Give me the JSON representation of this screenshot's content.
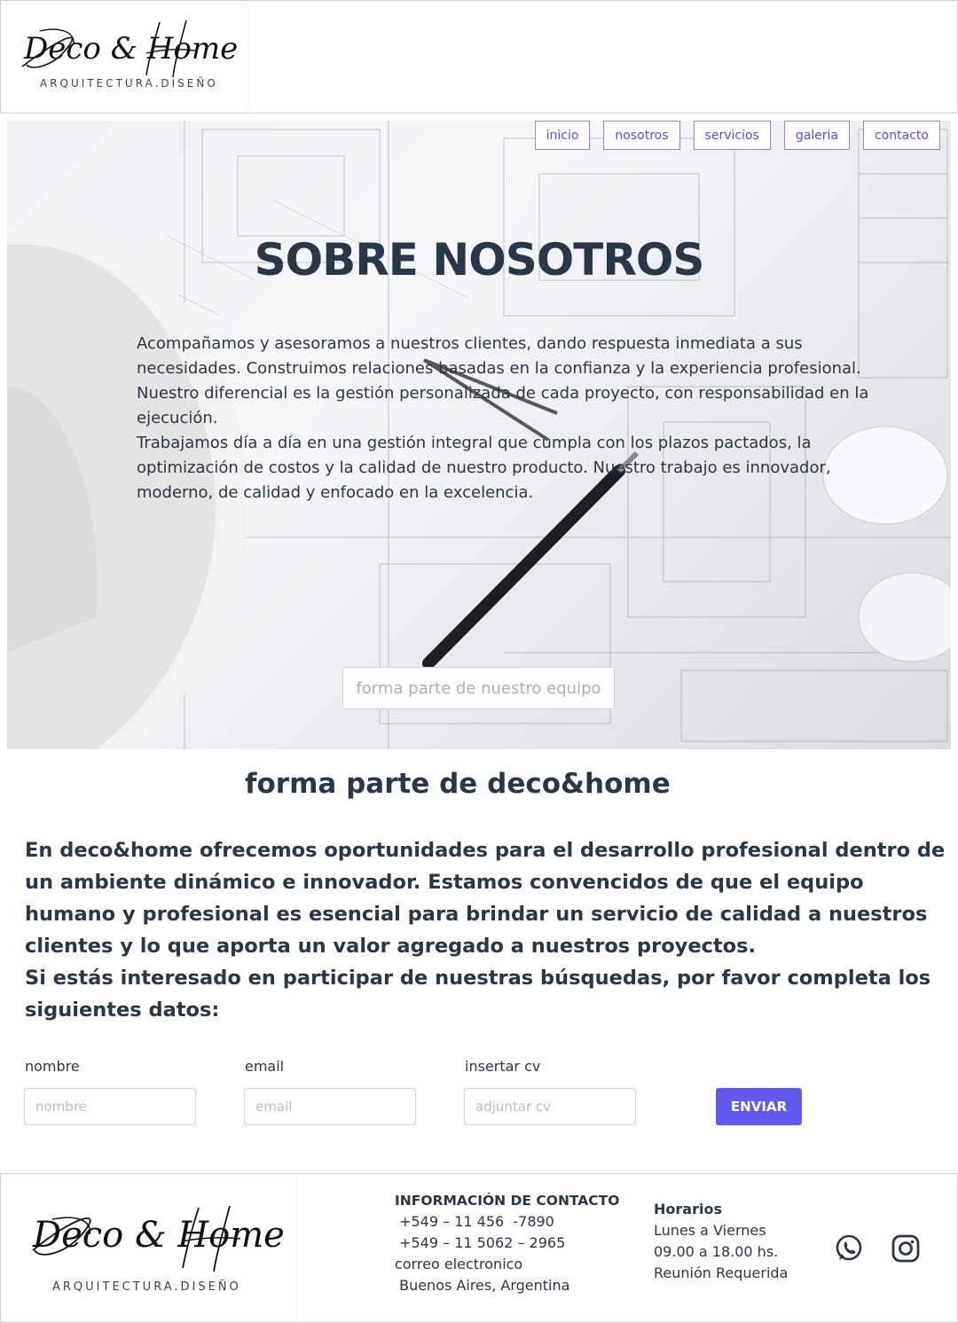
{
  "brand": {
    "logo_script": "Deco & Home",
    "logo_sub": "ARQUITECTURA.DISEÑO"
  },
  "nav": {
    "items": [
      {
        "label": "inicio"
      },
      {
        "label": "nosotros"
      },
      {
        "label": "servicios"
      },
      {
        "label": "galeria"
      },
      {
        "label": "contacto"
      }
    ],
    "accent_color": "#5a50d8"
  },
  "hero": {
    "title": "SOBRE NOSOTROS",
    "paragraph_1": "Acompañamos y asesoramos a nuestros clientes, dando respuesta inmediata a sus necesidades. Construimos relaciones basadas en la confianza y la experiencia profesional. Nuestro diferencial es la gestión personalizada de cada proyecto, con responsabilidad en la ejecución.",
    "paragraph_2": "Trabajamos día a día en una gestión integral que cumpla con los plazos pactados, la optimización de costos y la calidad de nuestro producto. Nuestro trabajo es innovador, moderno, de calidad y enfocado en la excelencia.",
    "cta_label": "forma parte de nuestro equipo"
  },
  "join": {
    "title": "forma parte de deco&home",
    "paragraph_1": "En deco&home ofrecemos oportunidades para el desarrollo profesional dentro de un ambiente dinámico e innovador. Estamos convencidos de que el equipo humano y profesional es esencial para brindar un servicio de calidad a nuestros clientes y lo que aporta un valor agregado a nuestros proyectos.",
    "paragraph_2": "Si estás interesado en participar de nuestras búsquedas, por favor completa los siguientes datos:"
  },
  "form": {
    "name_label": "nombre",
    "name_placeholder": "nombre",
    "email_label": "email",
    "email_placeholder": "email",
    "cv_label": "insertar cv",
    "cv_placeholder": "adjuntar cv",
    "submit_label": "ENVIAR",
    "submit_color": "#6358f0"
  },
  "footer": {
    "contact_heading": "INFORMACIÓN DE CONTACTO",
    "phone_1": " +549 – 11 456  -7890",
    "phone_2": " +549 – 11 5062 – 2965",
    "email_text": "correo electronico",
    "location": " Buenos Aires, Argentina",
    "hours_heading": "Horarios",
    "hours_days": "Lunes a Viernes",
    "hours_time": "09.00 a 18.00 hs.",
    "hours_note": "Reunión Requerida",
    "social_icons": [
      "whatsapp-icon",
      "instagram-icon"
    ]
  }
}
